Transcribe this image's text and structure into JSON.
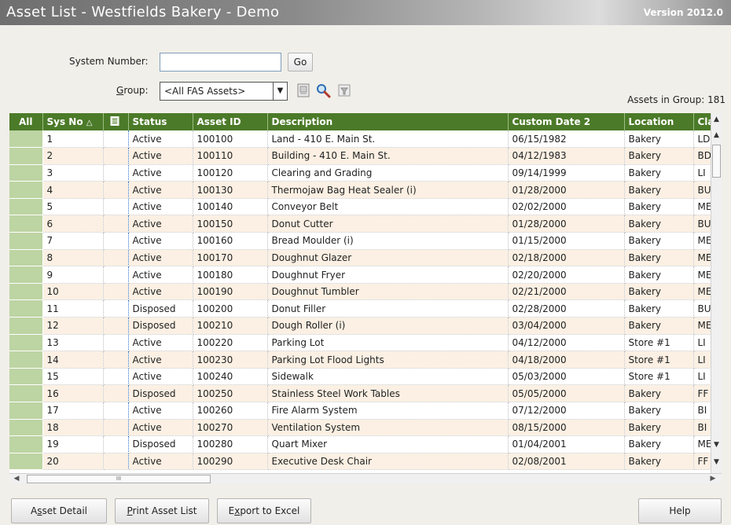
{
  "window": {
    "title": "Asset List - Westfields Bakery - Demo",
    "version": "Version 2012.0"
  },
  "form": {
    "system_number_label": "System Number:",
    "system_number_value": "",
    "go_label": "Go",
    "group_label": "Group:",
    "group_value": "<All FAS Assets>"
  },
  "assets_in_group": "Assets in Group:  181",
  "grid": {
    "columns": [
      "All",
      "Sys No",
      "",
      "Status",
      "Asset ID",
      "Description",
      "Custom Date 2",
      "Location",
      "Cla"
    ],
    "sort_indicator": "△",
    "rows": [
      [
        "1",
        "Active",
        "100100",
        "Land - 410 E. Main St.",
        "06/15/1982",
        "Bakery",
        "LD"
      ],
      [
        "2",
        "Active",
        "100110",
        "Building - 410 E. Main St.",
        "04/12/1983",
        "Bakery",
        "BD"
      ],
      [
        "3",
        "Active",
        "100120",
        "Clearing and Grading",
        "09/14/1999",
        "Bakery",
        "LI"
      ],
      [
        "4",
        "Active",
        "100130",
        "Thermojaw Bag Heat Sealer (i)",
        "01/28/2000",
        "Bakery",
        "BU"
      ],
      [
        "5",
        "Active",
        "100140",
        "Conveyor Belt",
        "02/02/2000",
        "Bakery",
        "ME"
      ],
      [
        "6",
        "Active",
        "100150",
        "Donut Cutter",
        "01/28/2000",
        "Bakery",
        "BU"
      ],
      [
        "7",
        "Active",
        "100160",
        "Bread  Moulder (i)",
        "01/15/2000",
        "Bakery",
        "ME"
      ],
      [
        "8",
        "Active",
        "100170",
        "Doughnut Glazer",
        "02/18/2000",
        "Bakery",
        "ME"
      ],
      [
        "9",
        "Active",
        "100180",
        "Doughnut Fryer",
        "02/20/2000",
        "Bakery",
        "ME"
      ],
      [
        "10",
        "Active",
        "100190",
        "Doughnut Tumbler",
        "02/21/2000",
        "Bakery",
        "ME"
      ],
      [
        "11",
        "Disposed",
        "100200",
        "Donut Filler",
        "02/28/2000",
        "Bakery",
        "BU"
      ],
      [
        "12",
        "Disposed",
        "100210",
        "Dough Roller (i)",
        "03/04/2000",
        "Bakery",
        "ME"
      ],
      [
        "13",
        "Active",
        "100220",
        "Parking Lot",
        "04/12/2000",
        "Store #1",
        "LI"
      ],
      [
        "14",
        "Active",
        "100230",
        "Parking Lot Flood Lights",
        "04/18/2000",
        "Store #1",
        "LI"
      ],
      [
        "15",
        "Active",
        "100240",
        "Sidewalk",
        "05/03/2000",
        "Store #1",
        "LI"
      ],
      [
        "16",
        "Disposed",
        "100250",
        "Stainless Steel Work Tables",
        "05/05/2000",
        "Bakery",
        "FF"
      ],
      [
        "17",
        "Active",
        "100260",
        "Fire Alarm System",
        "07/12/2000",
        "Bakery",
        "BI"
      ],
      [
        "18",
        "Active",
        "100270",
        "Ventilation System",
        "08/15/2000",
        "Bakery",
        "BI"
      ],
      [
        "19",
        "Disposed",
        "100280",
        "Quart Mixer",
        "01/04/2001",
        "Bakery",
        "ME"
      ],
      [
        "20",
        "Active",
        "100290",
        "Executive Desk Chair",
        "02/08/2001",
        "Bakery",
        "FF"
      ]
    ]
  },
  "hscroll_thumb": "III",
  "buttons": {
    "asset_detail": "Asset Detail",
    "print_asset_list": "Print Asset List",
    "export_to_excel": "Export to Excel",
    "help": "Help"
  },
  "colors": {
    "header_green": "#4b7a28",
    "select_cell": "#bdd4a3",
    "alt_row": "#fbf0e3"
  },
  "icons": [
    "report-icon",
    "search-icon",
    "filter-icon",
    "notes-icon"
  ]
}
